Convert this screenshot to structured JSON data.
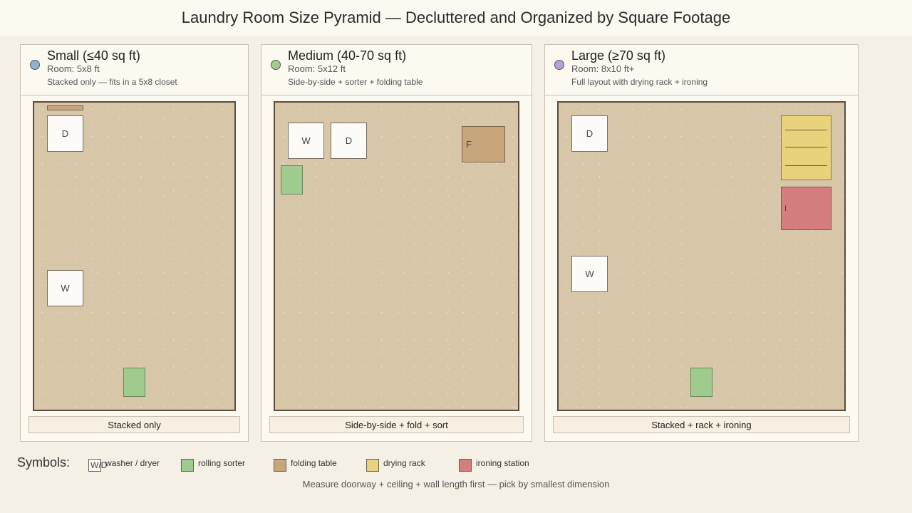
{
  "title": "Laundry Room Size Pyramid — Decluttered and Organized by Square Footage",
  "panels": [
    {
      "title": "Small (≤40 sq ft)",
      "room": "Room: 5x8 ft",
      "description": "Stacked only — fits in a 5x8 closet",
      "caption": "Stacked only",
      "color": "#8fb1d2",
      "labels": {
        "dryer": "D",
        "washer": "W"
      }
    },
    {
      "title": "Medium (40-70 sq ft)",
      "room": "Room: 5x12 ft",
      "description": "Side-by-side + sorter + folding table",
      "caption": "Side-by-side + fold + sort",
      "color": "#9fcb8e",
      "labels": {
        "washer": "W",
        "dryer": "D",
        "table": "F"
      }
    },
    {
      "title": "Large (≥70 sq ft)",
      "room": "Room: 8x10 ft+",
      "description": "Full layout with drying rack + ironing",
      "caption": "Stacked + rack + ironing",
      "color": "#b9a1cf",
      "labels": {
        "dryer": "D",
        "washer": "W",
        "ironing": "I"
      }
    }
  ],
  "legend": {
    "title": "Symbols:",
    "swatch_text": "W/D",
    "items": [
      {
        "label": "washer / dryer",
        "color": "#fcfbf8"
      },
      {
        "label": "rolling sorter",
        "color": "#9fcb8e"
      },
      {
        "label": "folding table",
        "color": "#c8a67c"
      },
      {
        "label": "drying rack",
        "color": "#e8d27c"
      },
      {
        "label": "ironing station",
        "color": "#d47e80"
      }
    ]
  },
  "note": "Measure doorway + ceiling + wall length first — pick by smallest dimension"
}
